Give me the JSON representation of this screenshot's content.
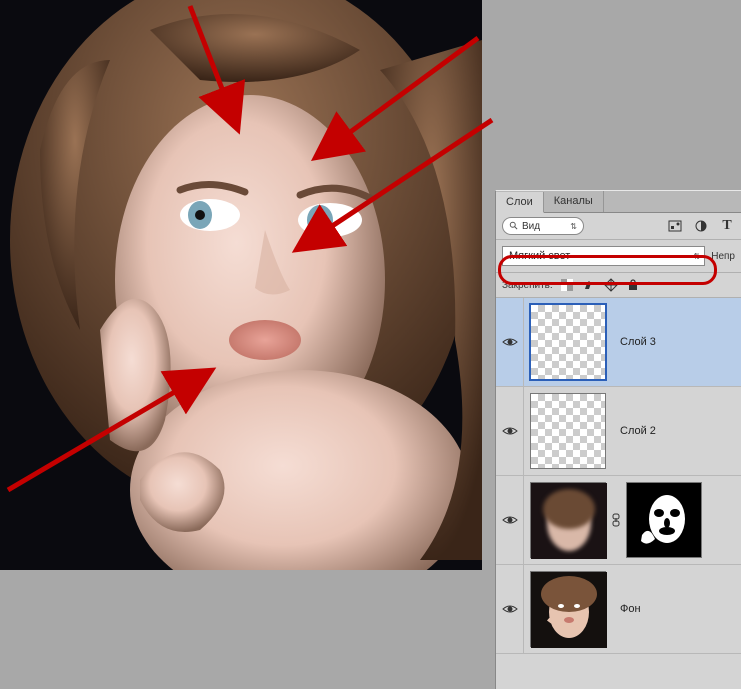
{
  "panel": {
    "tabs": {
      "layers": "Слои",
      "channels": "Каналы"
    },
    "search": {
      "label": "Вид"
    },
    "blend_mode": {
      "value": "Мягкий свет"
    },
    "opacity_label_cut": "Непр",
    "lock": {
      "label": "Закрепить:"
    },
    "layers": [
      {
        "name": "Слой 3",
        "selected": true,
        "type": "transparent"
      },
      {
        "name": "Слой 2",
        "selected": false,
        "type": "transparent"
      },
      {
        "name": "",
        "selected": false,
        "type": "photo-mask"
      },
      {
        "name": "Фон",
        "selected": false,
        "type": "photo"
      }
    ]
  }
}
